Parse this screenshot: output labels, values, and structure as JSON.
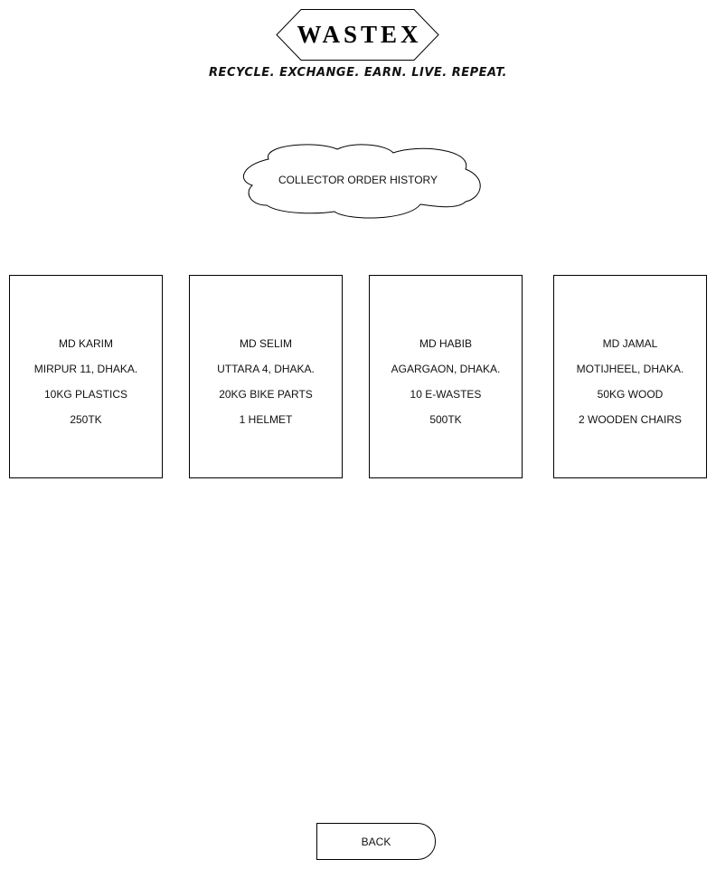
{
  "app": {
    "logo_text": "WASTEX",
    "tagline": "RECYCLE. EXCHANGE. EARN. LIVE. REPEAT."
  },
  "page": {
    "title": "COLLECTOR ORDER HISTORY"
  },
  "orders": [
    {
      "name": "MD KARIM",
      "address": "MIRPUR 11, DHAKA.",
      "item": "10KG PLASTICS",
      "extra": "250TK"
    },
    {
      "name": "MD SELIM",
      "address": "UTTARA 4, DHAKA.",
      "item": "20KG BIKE PARTS",
      "extra": "1 HELMET"
    },
    {
      "name": "MD HABIB",
      "address": "AGARGAON, DHAKA.",
      "item": "10 E-WASTES",
      "extra": "500TK"
    },
    {
      "name": "MD JAMAL",
      "address": "MOTIJHEEL, DHAKA.",
      "item": "50KG WOOD",
      "extra": "2 WOODEN CHAIRS"
    }
  ],
  "actions": {
    "back_label": "BACK"
  }
}
